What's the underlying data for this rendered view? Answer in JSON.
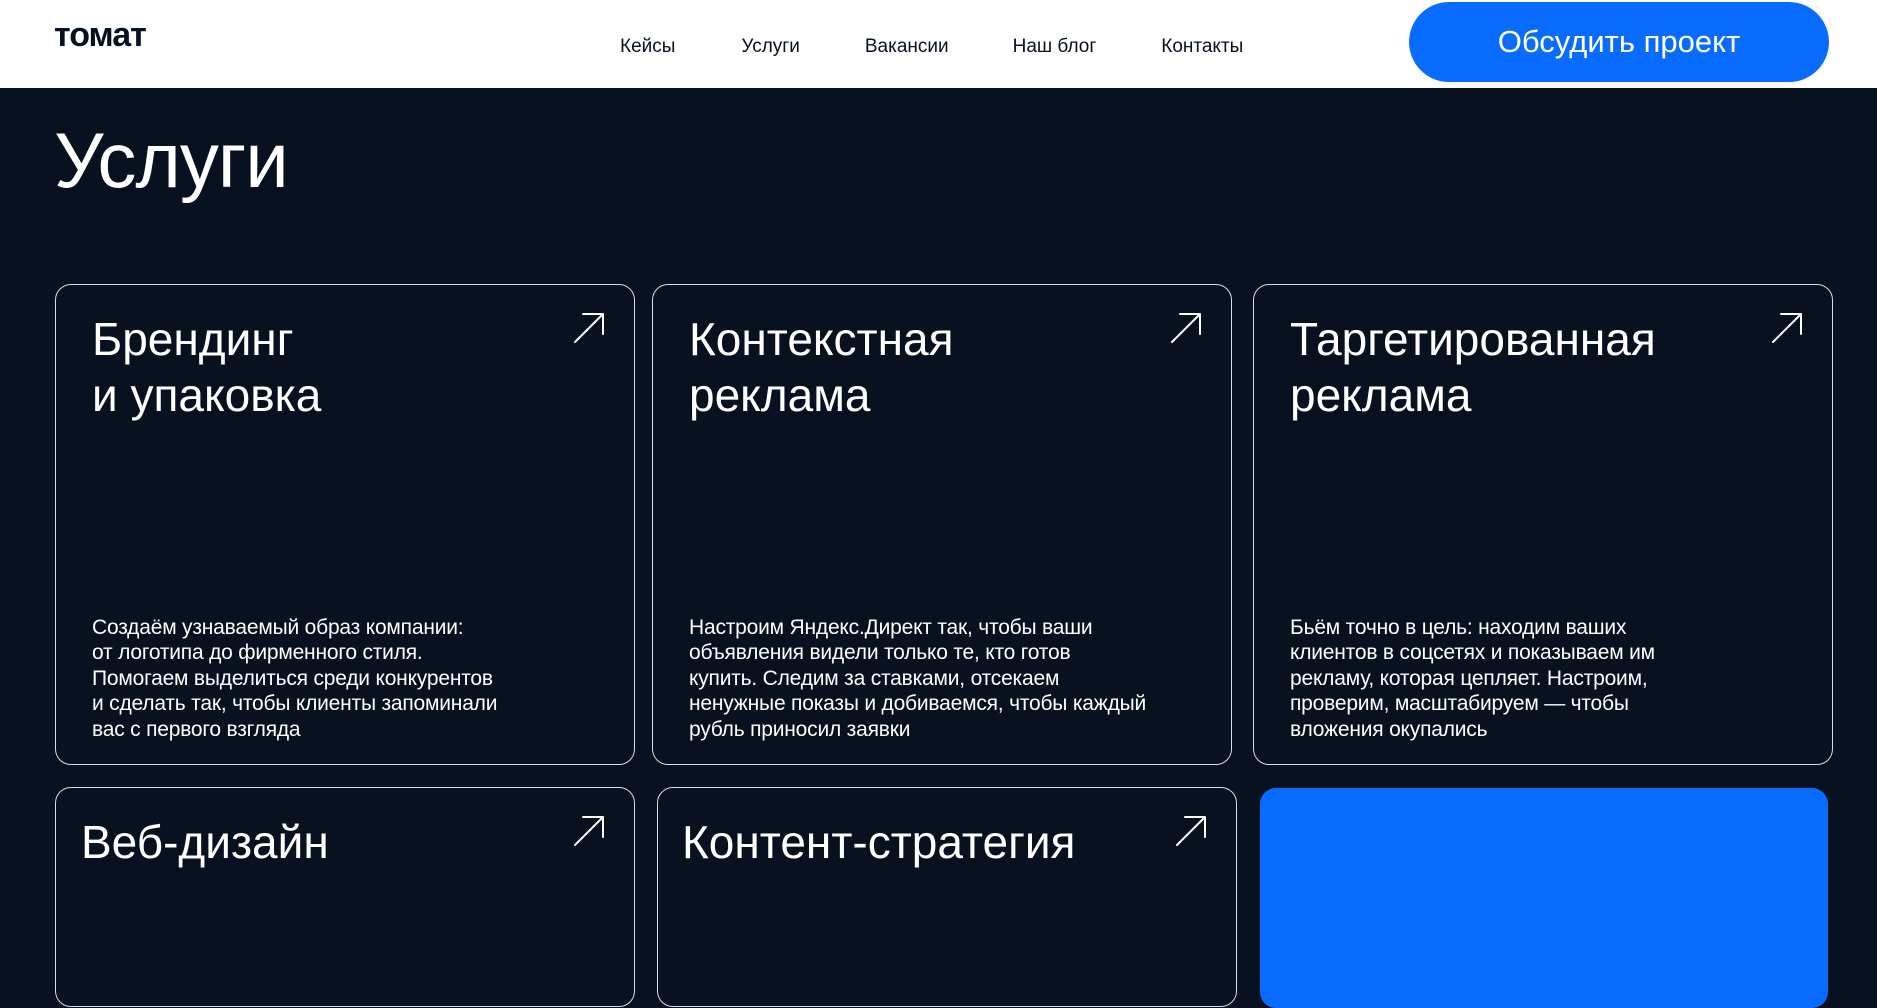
{
  "header": {
    "logo": "томат",
    "nav": [
      "Кейсы",
      "Услуги",
      "Вакансии",
      "Наш блог",
      "Контакты"
    ],
    "cta_label": "Обсудить проект"
  },
  "page": {
    "title": "Услуги"
  },
  "services": [
    {
      "title_lines": [
        "Брендинг",
        "и упаковка"
      ],
      "desc_lines": [
        "Создаём узнаваемый образ компании:",
        "от логотипа до фирменного стиля.",
        "Помогаем выделиться среди конкурентов",
        "и сделать так, чтобы клиенты запоминали",
        "вас с первого взгляда"
      ]
    },
    {
      "title_lines": [
        "Контекстная",
        "реклама"
      ],
      "desc_lines": [
        "Настроим Яндекс.Директ так, чтобы ваши",
        "объявления видели только те, кто готов",
        "купить. Следим за ставками, отсекаем",
        "ненужные показы и добиваемся, чтобы каждый",
        "рубль приносил заявки"
      ]
    },
    {
      "title_lines": [
        "Таргетированная",
        "реклама"
      ],
      "desc_lines": [
        "Бьём точно в цель: находим ваших",
        "клиентов в соцсетях и показываем им",
        "рекламу, которая цепляет. Настроим,",
        "проверим, масштабируем — чтобы",
        "вложения окупались"
      ]
    },
    {
      "title_lines": [
        "Веб-дизайн"
      ],
      "desc_lines": []
    },
    {
      "title_lines": [
        "Контент-стратегия"
      ],
      "desc_lines": []
    }
  ],
  "colors": {
    "background": "#07111f",
    "accent": "#0a6cff",
    "header_bg": "#ffffff",
    "card_border": "#d9dde4"
  },
  "icons": {
    "card_arrow": "arrow-up-right-icon"
  }
}
